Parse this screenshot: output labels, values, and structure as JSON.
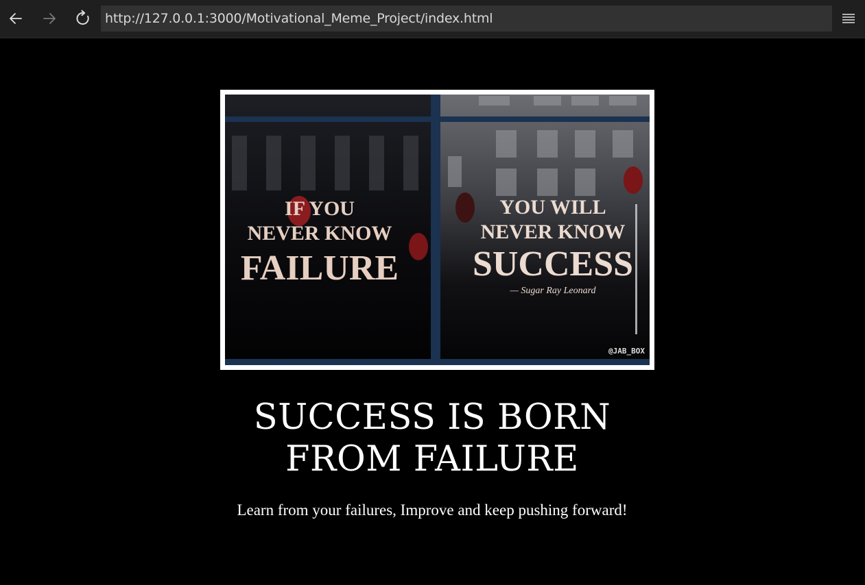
{
  "browser": {
    "url": "http://127.0.0.1:3000/Motivational_Meme_Project/index.html",
    "icons": {
      "back": "arrow-left-icon",
      "forward": "arrow-right-icon",
      "reload": "reload-icon",
      "menu": "hamburger-menu-icon"
    }
  },
  "meme": {
    "left_text": [
      "IF YOU",
      "NEVER KNOW",
      "FAILURE"
    ],
    "right_text": [
      "YOU WILL",
      "NEVER KNOW",
      "SUCCESS"
    ],
    "attribution": "— Sugar Ray Leonard",
    "watermark": "@JAB_BOX"
  },
  "main": {
    "headline_line1": "SUCCESS IS BORN",
    "headline_line2": "FROM FAILURE",
    "subtitle": "Learn from your failures, Improve and keep pushing forward!"
  },
  "colors": {
    "background": "#000000",
    "toolbar": "#1f1f1f",
    "address_bar": "#323232",
    "meme_text": "#e8d2c4",
    "window_frame": "#1b3250"
  }
}
